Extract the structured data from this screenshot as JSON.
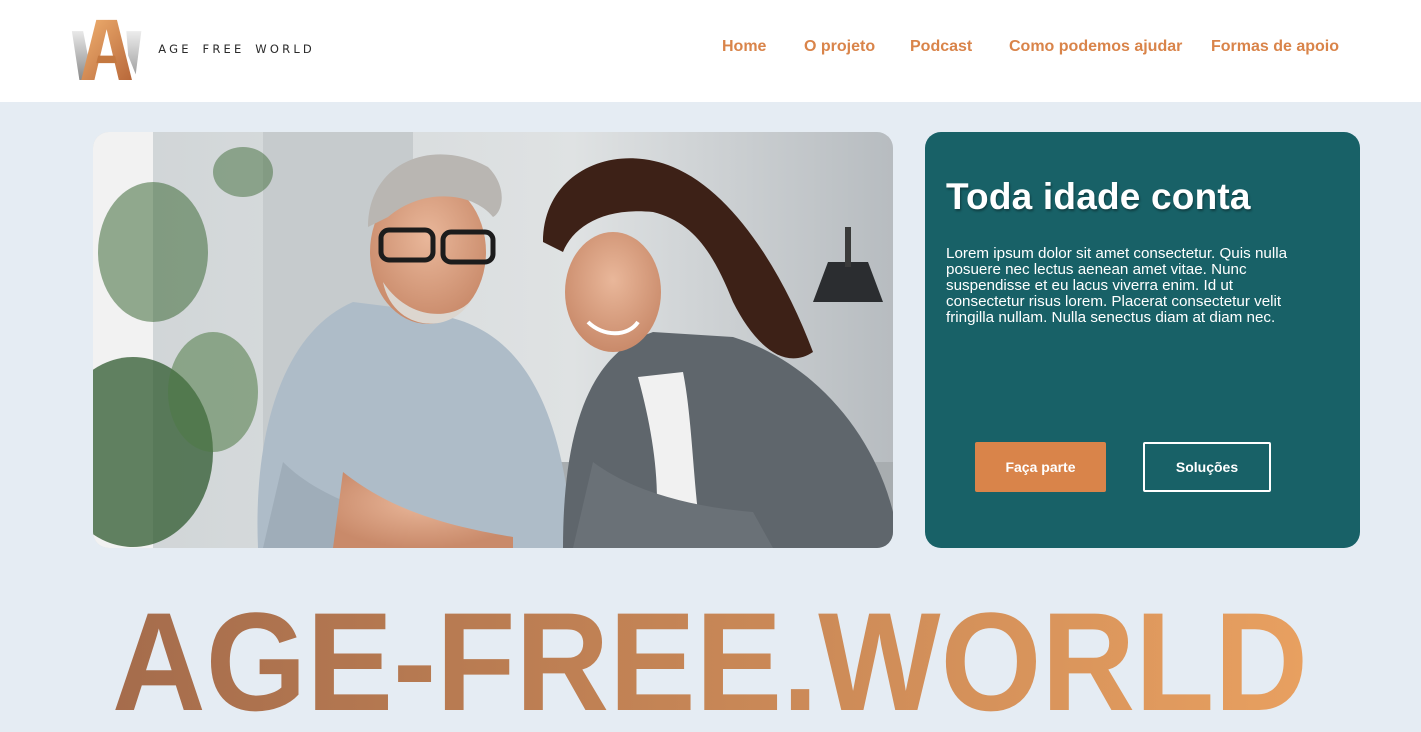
{
  "brand": {
    "name": "AGE FREE WORLD",
    "logo_letter": "A",
    "accent_color": "#d9844a"
  },
  "nav": {
    "items": [
      {
        "label": "Home"
      },
      {
        "label": "O projeto"
      },
      {
        "label": "Podcast"
      },
      {
        "label": "Como podemos ajudar"
      },
      {
        "label": "Formas de apoio"
      }
    ]
  },
  "hero": {
    "image": "photo-older-man-and-young-woman-working-together-icon",
    "card": {
      "title": "Toda idade conta",
      "body": "Lorem ipsum dolor sit amet consectetur. Quis nulla posuere nec lectus aenean amet vitae. Nunc suspendisse et eu lacus viverra enim. Id ut consectetur risus lorem. Placerat consectetur velit fringilla nullam. Nulla senectus diam at diam nec.",
      "background_color": "#186167",
      "primary_button": "Faça parte",
      "secondary_button": "Soluções"
    }
  },
  "banner": {
    "text": "AGE-FREE.WORLD",
    "gradient": [
      "#a56c4c",
      "#e8a060"
    ]
  }
}
